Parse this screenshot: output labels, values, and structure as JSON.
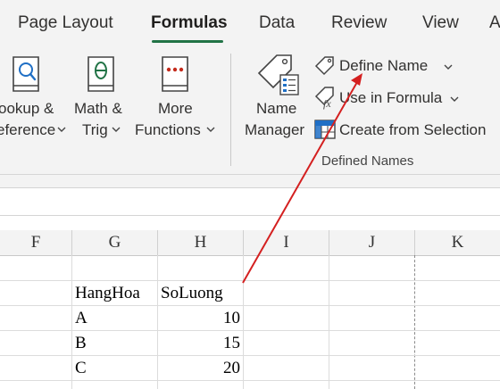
{
  "tabs": [
    {
      "label": "Page Layout",
      "active": false
    },
    {
      "label": "Formulas",
      "active": true
    },
    {
      "label": "Data",
      "active": false
    },
    {
      "label": "Review",
      "active": false
    },
    {
      "label": "View",
      "active": false
    },
    {
      "label": "A",
      "active": false
    }
  ],
  "function_library": {
    "lookup": {
      "line1": "ookup &",
      "line2": "eference",
      "icon": "search-book-icon"
    },
    "math": {
      "line1": "Math &",
      "line2": "Trig",
      "icon": "theta-book-icon"
    },
    "more": {
      "line1": "More",
      "line2": "Functions",
      "icon": "dots-book-icon"
    }
  },
  "defined_names": {
    "name_manager": {
      "line1": "Name",
      "line2": "Manager",
      "icon": "name-manager-icon"
    },
    "define_name": {
      "label": "Define Name",
      "icon": "tag-icon"
    },
    "use_in_formula": {
      "label": "Use in Formula",
      "icon": "fx-tag-icon"
    },
    "create_from_selection": {
      "label": "Create from Selection",
      "icon": "table-grid-icon"
    },
    "group_label": "Defined Names"
  },
  "columns": [
    "F",
    "G",
    "H",
    "I",
    "J",
    "K"
  ],
  "table": {
    "headers": [
      "HangHoa",
      "SoLuong"
    ],
    "rows": [
      {
        "item": "A",
        "qty": "10"
      },
      {
        "item": "B",
        "qty": "15"
      },
      {
        "item": "C",
        "qty": "20"
      }
    ]
  },
  "colors": {
    "accent": "#217346",
    "arrow": "#d42020"
  }
}
